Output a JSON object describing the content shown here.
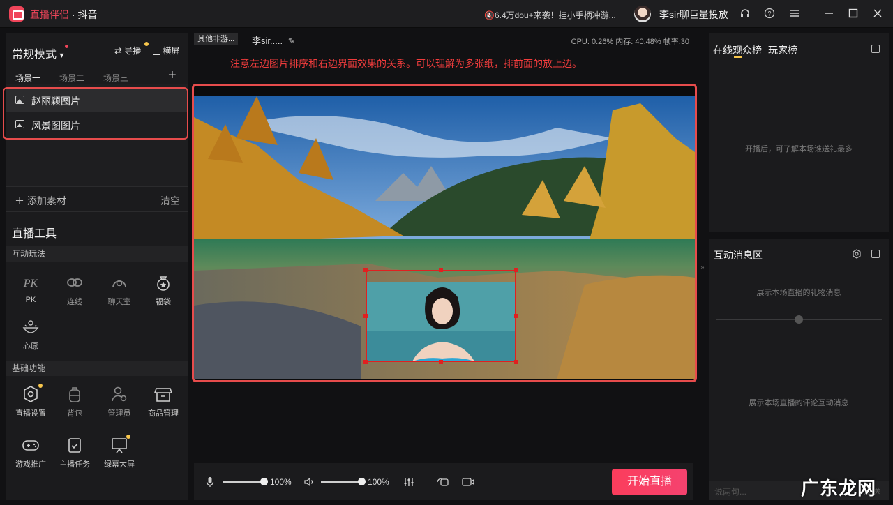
{
  "app": {
    "name": "直播伴侣",
    "separator": " · ",
    "platform": "抖音",
    "ticker": "🔇6.4万dou+来袭！挂小手柄冲游...",
    "username": "李sir聊巨量投放"
  },
  "left": {
    "mode_label": "常规模式",
    "mode_arrow": "▾",
    "guide_label": "导播",
    "landscape_label": "横屏",
    "tabs": [
      "场景一",
      "场景二",
      "场景三"
    ],
    "add_tab": "+",
    "scenes": [
      "赵丽颖图片",
      "风景图图片"
    ],
    "add_material": "添加素材",
    "clear": "清空",
    "tools_title": "直播工具",
    "section_interactive": "互动玩法",
    "interactive_tools": [
      "PK",
      "连线",
      "聊天室",
      "福袋",
      "心愿"
    ],
    "section_basic": "基础功能",
    "basic_tools": [
      "直播设置",
      "背包",
      "管理员",
      "商品管理",
      "游戏推广",
      "主播任务",
      "绿幕大屏"
    ]
  },
  "center": {
    "game_tag": "其他非游...",
    "stream_name": "李sir.....",
    "stats": "CPU: 0.26%   内存: 40.48%   帧率:30",
    "notice": "注意左边图片排序和右边界面效果的关系。可以理解为多张纸，排前面的放上边。",
    "mic_volume": "100%",
    "speaker_volume": "100%",
    "mic_level": 1.0,
    "speaker_level": 1.0,
    "start_button": "开始直播"
  },
  "right": {
    "tab_viewers": "在线观众榜",
    "tab_players": "玩家榜",
    "viewers_hint": "开播后，可了解本场谁送礼最多",
    "interaction_title": "互动消息区",
    "gift_hint": "展示本场直播的礼物消息",
    "comment_hint": "展示本场直播的评论互动消息",
    "chat_placeholder": "说两句...",
    "send": "发送"
  },
  "watermark": "广东龙网",
  "colors": {
    "accent": "#f0455a",
    "highlight": "#e74c4c",
    "notice": "#f03c3c",
    "badge": "#f7c64c"
  }
}
